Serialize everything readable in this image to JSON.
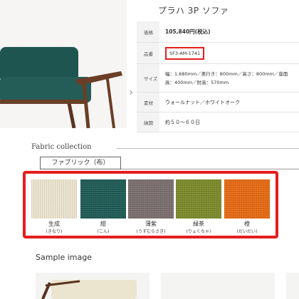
{
  "product": {
    "title": "プラハ 3P ソファ",
    "specs": [
      {
        "label": "価格",
        "value": "105,840円(税込)"
      },
      {
        "label": "品番",
        "value": "SF3-AM-1741"
      },
      {
        "label": "サイズ",
        "value_line1": "幅：1,680mm／奥行き：800mm／高さ：800mm／座面",
        "value_line2": "高：400mm／肘高：570mm"
      },
      {
        "label": "素材",
        "value": "ウォールナット／ホワイトオーク"
      },
      {
        "label": "納期",
        "value": "約５０～６０日"
      }
    ]
  },
  "fabric_collection": {
    "heading": "Fabric collection",
    "tab_label": "ファブリック（布）",
    "swatches": [
      {
        "name": "生成",
        "reading": "(きなり)",
        "color": "#ece5cf"
      },
      {
        "name": "紺",
        "reading": "(こん)",
        "color": "#1e5a56"
      },
      {
        "name": "薄紫",
        "reading": "(うすむらさき)",
        "color": "#7b6e6e"
      },
      {
        "name": "緑茶",
        "reading": "(りょくちゃ)",
        "color": "#7c8a2a"
      },
      {
        "name": "橙",
        "reading": "(だいだい)",
        "color": "#e66a12"
      }
    ]
  },
  "sample": {
    "heading": "Sample image"
  },
  "colors": {
    "highlight_red": "#e41e1e",
    "sofa_fabric": "#1f5550",
    "wood": "#6b3e26"
  },
  "icons": {
    "next": "›"
  }
}
